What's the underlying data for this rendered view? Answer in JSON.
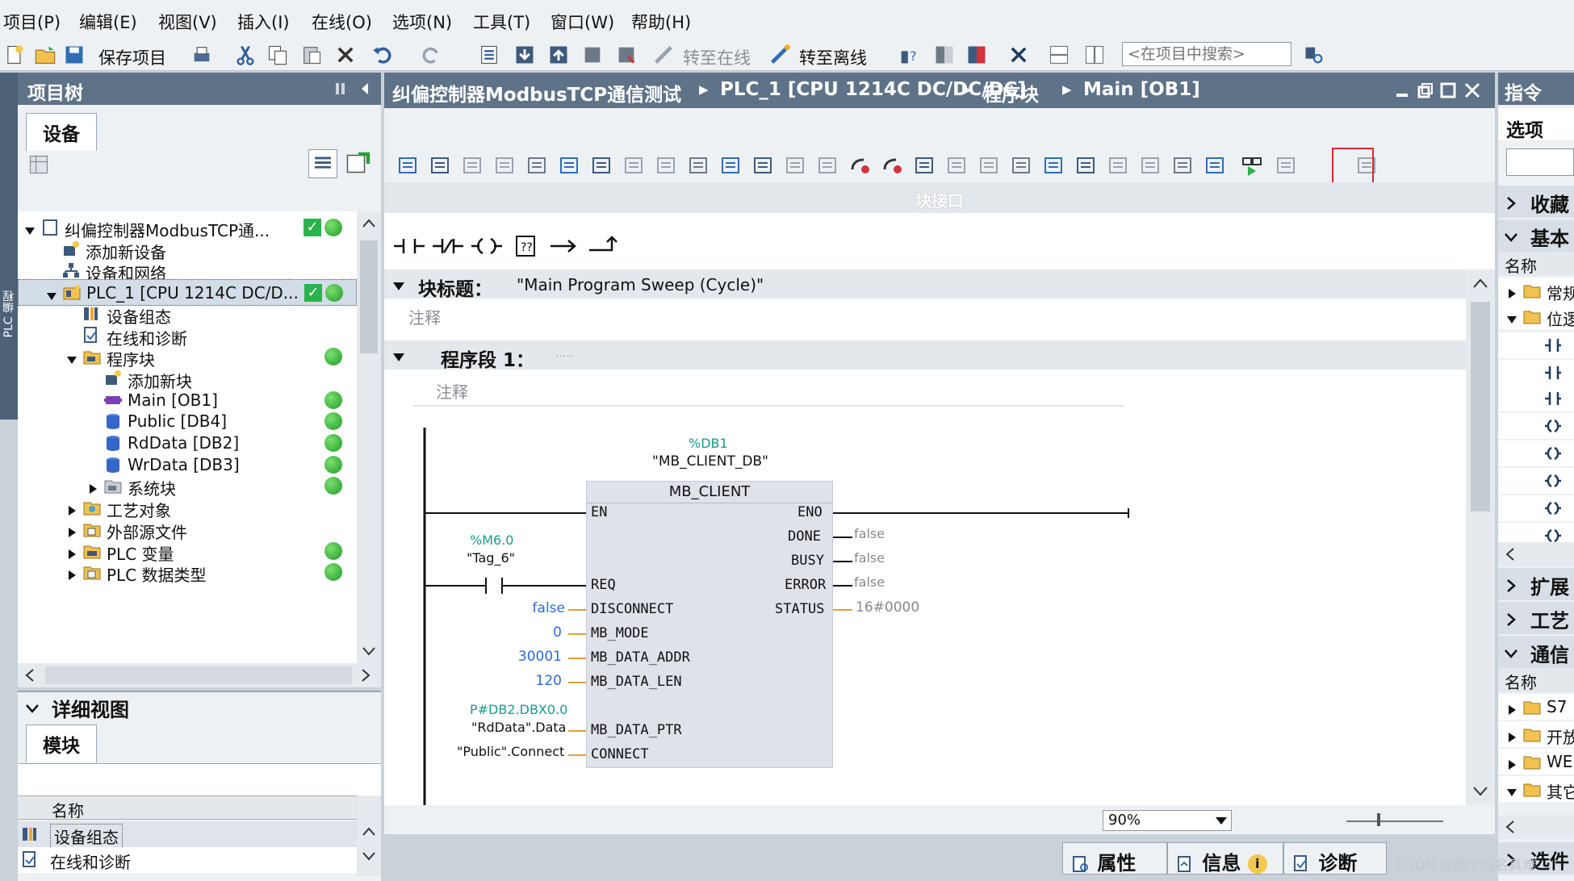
{
  "menu": [
    "项目(P)",
    "编辑(E)",
    "视图(V)",
    "插入(I)",
    "在线(O)",
    "选项(N)",
    "工具(T)",
    "窗口(W)",
    "帮助(H)"
  ],
  "toolbar": {
    "save_label": "保存项目",
    "go_online": "转至在线",
    "go_offline": "转至离线",
    "search_placeholder": "<在项目中搜索>"
  },
  "project_tree": {
    "title": "项目树",
    "tab": "设备",
    "side_label": "PLC 编程",
    "items": [
      {
        "label": "纠偏控制器ModbusTCP通...",
        "status": "check-dot"
      },
      {
        "label": "添加新设备",
        "status": ""
      },
      {
        "label": "设备和网络",
        "status": ""
      },
      {
        "label": "PLC_1 [CPU 1214C DC/D...",
        "status": "check-dot"
      },
      {
        "label": "设备组态",
        "status": ""
      },
      {
        "label": "在线和诊断",
        "status": ""
      },
      {
        "label": "程序块",
        "status": "dot"
      },
      {
        "label": "添加新块",
        "status": ""
      },
      {
        "label": "Main [OB1]",
        "status": "dot"
      },
      {
        "label": "Public [DB4]",
        "status": "dot"
      },
      {
        "label": "RdData [DB2]",
        "status": "dot"
      },
      {
        "label": "WrData [DB3]",
        "status": "dot"
      },
      {
        "label": "系统块",
        "status": "dot"
      },
      {
        "label": "工艺对象",
        "status": ""
      },
      {
        "label": "外部源文件",
        "status": ""
      },
      {
        "label": "PLC 变量",
        "status": "dot"
      },
      {
        "label": "PLC 数据类型",
        "status": "dot"
      }
    ]
  },
  "detail_view": {
    "title": "详细视图",
    "tab": "模块",
    "column": "名称",
    "items": [
      "设备组态",
      "在线和诊断"
    ]
  },
  "editor": {
    "breadcrumb": [
      "纠偏控制器ModbusTCP通信测试",
      "PLC_1 [CPU 1214C DC/DC/DC]",
      "程序块",
      "Main [OB1]"
    ],
    "interface_label": "块接口",
    "block_title_label": "块标题：",
    "block_title_value": "\"Main Program Sweep (Cycle)\"",
    "comment": "注释",
    "network_label": "程序段 1：",
    "network_dots": ".....",
    "zoom": "90%"
  },
  "fb": {
    "db_addr": "%DB1",
    "db_name": "\"MB_CLIENT_DB\"",
    "name": "MB_CLIENT",
    "in_pins": [
      "EN",
      "REQ",
      "DISCONNECT",
      "MB_MODE",
      "MB_DATA_ADDR",
      "MB_DATA_LEN",
      "MB_DATA_PTR",
      "CONNECT"
    ],
    "out_pins": [
      "ENO",
      "DONE",
      "BUSY",
      "ERROR",
      "STATUS"
    ],
    "req_addr": "%M6.0",
    "req_tag": "\"Tag_6\"",
    "disconnect_val": "false",
    "mode_val": "0",
    "addr_val": "30001",
    "len_val": "120",
    "ptr_addr": "P#DB2.DBX0.0",
    "ptr_tag": "\"RdData\".Data",
    "connect_val": "\"Public\".Connect",
    "done_val": "false",
    "busy_val": "false",
    "error_val": "false",
    "status_val": "16#0000"
  },
  "right_panel": {
    "title": "指令",
    "options": "选项",
    "sections": [
      "收藏",
      "基本",
      "扩展",
      "工艺",
      "通信",
      "选件"
    ],
    "col_name": "名称",
    "folders_basic": [
      "常规",
      "位逻"
    ],
    "folders_comm": [
      "S7",
      "开放",
      "WE",
      "其它"
    ]
  },
  "bottom_tabs": [
    "属性",
    "信息",
    "诊断"
  ],
  "watermark": "CSDN @起个网名真难"
}
